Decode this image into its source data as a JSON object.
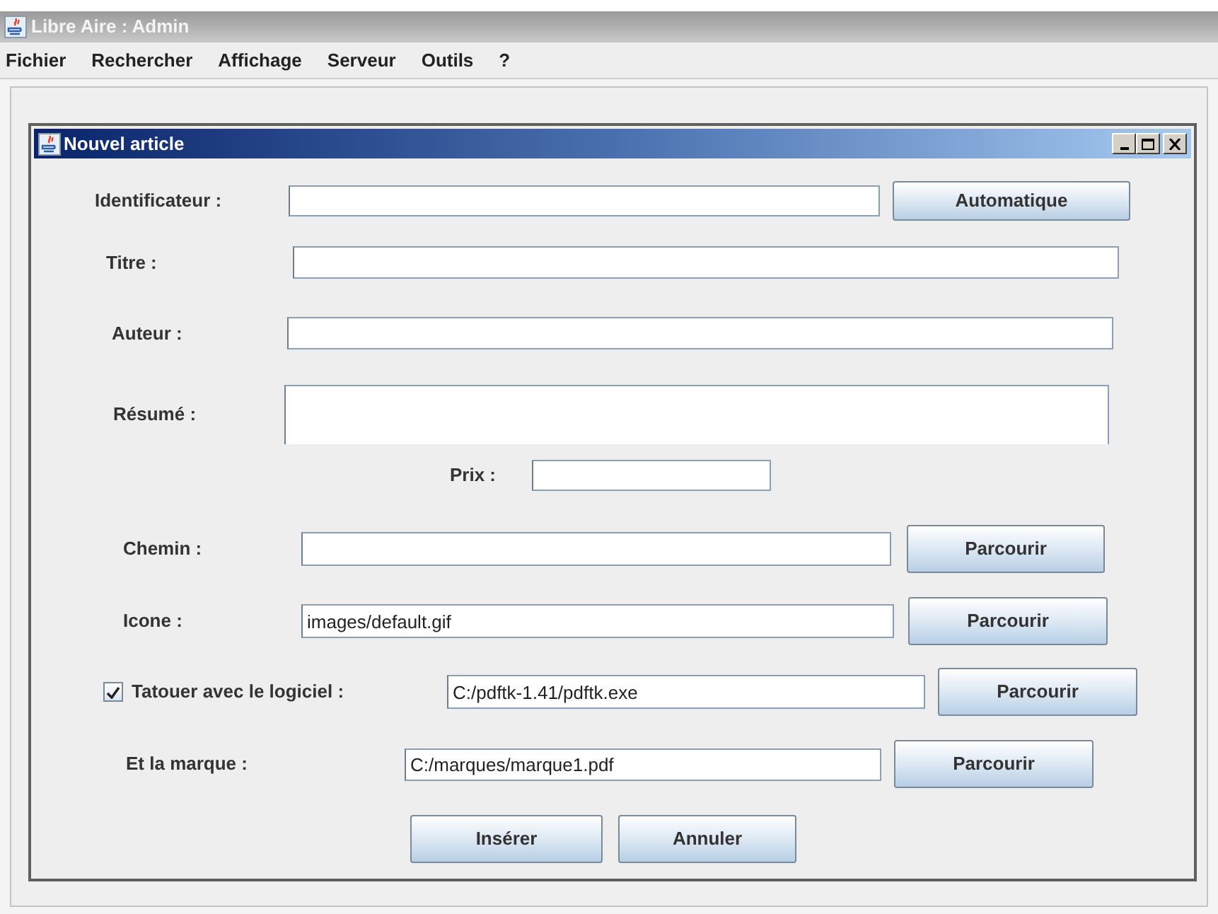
{
  "window": {
    "title": "Libre Aire : Admin"
  },
  "menu": [
    "Fichier",
    "Rechercher",
    "Affichage",
    "Serveur",
    "Outils",
    "?"
  ],
  "dialog": {
    "title": "Nouvel article",
    "fields": [
      {
        "kind": "text",
        "label": "Identificateur :",
        "button": "Automatique"
      },
      {
        "kind": "text",
        "label": "Titre :"
      },
      {
        "kind": "text",
        "label": "Auteur :"
      },
      {
        "kind": "textarea",
        "label": "Résumé :"
      },
      {
        "kind": "text",
        "label": "Prix :"
      },
      {
        "kind": "text",
        "label": "Chemin :",
        "button": "Parcourir"
      },
      {
        "kind": "text",
        "label": "Icone :",
        "value": "images/default.gif",
        "button": "Parcourir"
      },
      {
        "kind": "checkbox",
        "label": "Tatouer avec le logiciel :",
        "checked": true,
        "value": "C:/pdftk-1.41/pdftk.exe",
        "button": "Parcourir"
      },
      {
        "kind": "text",
        "label": "Et la marque :",
        "value": "C:/marques/marque1.pdf",
        "button": "Parcourir"
      }
    ],
    "buttons": [
      "Insérer",
      "Annuler"
    ]
  }
}
